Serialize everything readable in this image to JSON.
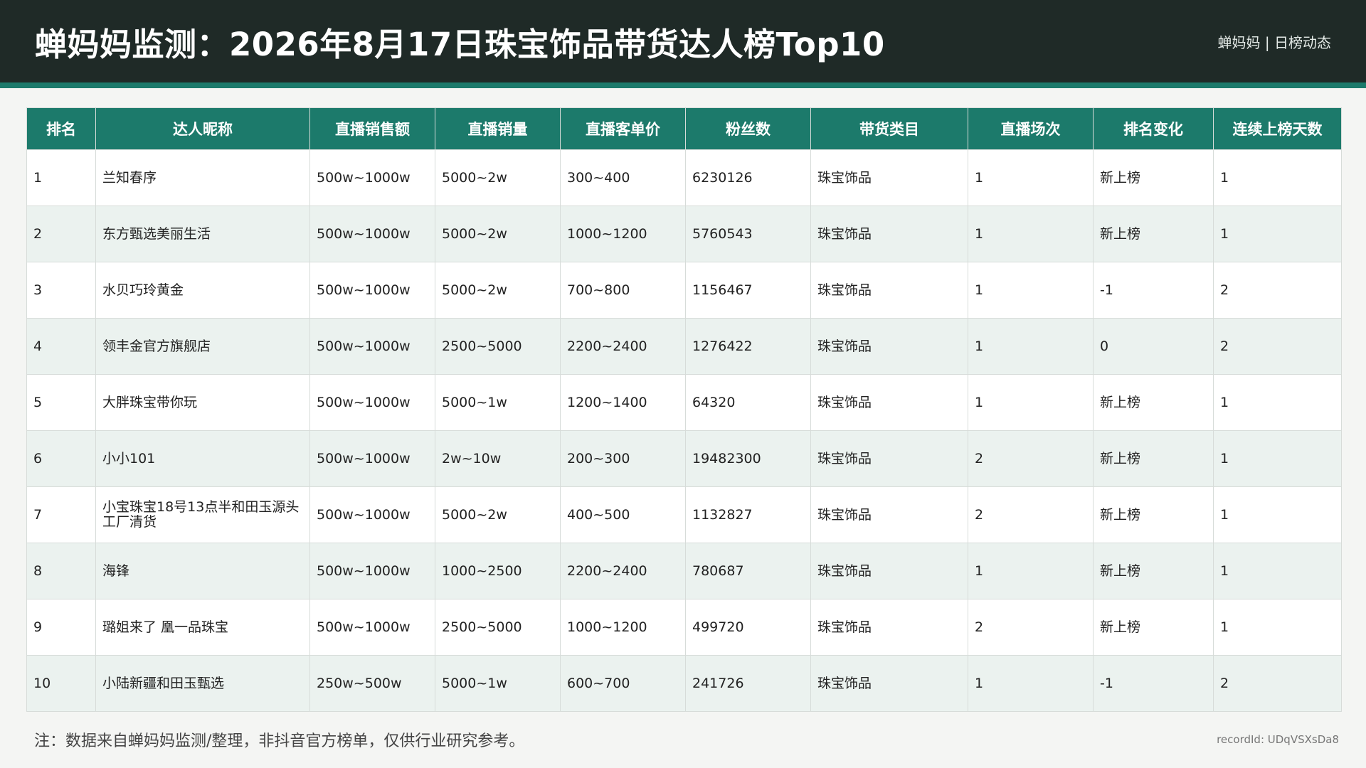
{
  "header": {
    "title": "蝉妈妈监测：2026年8月17日珠宝饰品带货达人榜Top10",
    "brand": "蝉妈妈 | 日榜动态"
  },
  "table": {
    "columns": [
      "排名",
      "达人昵称",
      "直播销售额",
      "直播销量",
      "直播客单价",
      "粉丝数",
      "带货类目",
      "直播场次",
      "排名变化",
      "连续上榜天数"
    ],
    "rows": [
      [
        "1",
        "兰知春序",
        "500w~1000w",
        "5000~2w",
        "300~400",
        "6230126",
        "珠宝饰品",
        "1",
        "新上榜",
        "1"
      ],
      [
        "2",
        "东方甄选美丽生活",
        "500w~1000w",
        "5000~2w",
        "1000~1200",
        "5760543",
        "珠宝饰品",
        "1",
        "新上榜",
        "1"
      ],
      [
        "3",
        "水贝巧玲黄金",
        "500w~1000w",
        "5000~2w",
        "700~800",
        "1156467",
        "珠宝饰品",
        "1",
        "-1",
        "2"
      ],
      [
        "4",
        "领丰金官方旗舰店",
        "500w~1000w",
        "2500~5000",
        "2200~2400",
        "1276422",
        "珠宝饰品",
        "1",
        "0",
        "2"
      ],
      [
        "5",
        "大胖珠宝带你玩",
        "500w~1000w",
        "5000~1w",
        "1200~1400",
        "64320",
        "珠宝饰品",
        "1",
        "新上榜",
        "1"
      ],
      [
        "6",
        "小小101",
        "500w~1000w",
        "2w~10w",
        "200~300",
        "19482300",
        "珠宝饰品",
        "2",
        "新上榜",
        "1"
      ],
      [
        "7",
        "小宝珠宝18号13点半和田玉源头工厂清货",
        "500w~1000w",
        "5000~2w",
        "400~500",
        "1132827",
        "珠宝饰品",
        "2",
        "新上榜",
        "1"
      ],
      [
        "8",
        "海锋",
        "500w~1000w",
        "1000~2500",
        "2200~2400",
        "780687",
        "珠宝饰品",
        "1",
        "新上榜",
        "1"
      ],
      [
        "9",
        "璐姐来了 凰一品珠宝",
        "500w~1000w",
        "2500~5000",
        "1000~1200",
        "499720",
        "珠宝饰品",
        "2",
        "新上榜",
        "1"
      ],
      [
        "10",
        "小陆新疆和田玉甄选",
        "250w~500w",
        "5000~1w",
        "600~700",
        "241726",
        "珠宝饰品",
        "1",
        "-1",
        "2"
      ]
    ]
  },
  "footer": {
    "note": "注：数据来自蝉妈妈监测/整理，非抖音官方榜单，仅供行业研究参考。",
    "record": "recordId: UDqVSXsDa8"
  },
  "colors": {
    "header_bg": "#1f2a27",
    "accent": "#1c7a6b",
    "row_alt": "#ebf2ef"
  }
}
